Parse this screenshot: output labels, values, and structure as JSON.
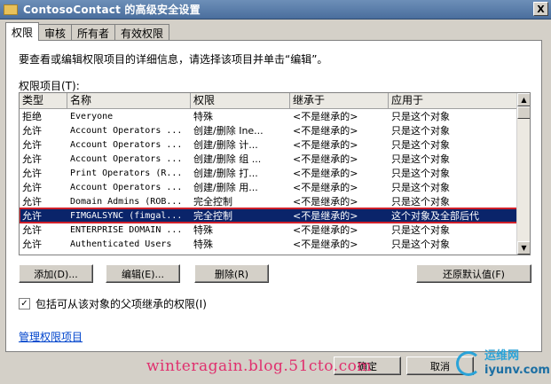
{
  "window": {
    "title": "ContosoContact 的高级安全设置",
    "close": "X"
  },
  "tabs": [
    {
      "label": "权限"
    },
    {
      "label": "审核"
    },
    {
      "label": "所有者"
    },
    {
      "label": "有效权限"
    }
  ],
  "description": "要查看或编辑权限项目的详细信息，请选择该项目并单击“编辑”。",
  "permissions_label": "权限项目(T):",
  "columns": [
    "类型",
    "名称",
    "权限",
    "继承于",
    "应用于"
  ],
  "rows": [
    [
      "拒绝",
      "Everyone",
      "特殊",
      "<不是继承的>",
      "只是这个对象"
    ],
    [
      "允许",
      "Account Operators ...",
      "创建/删除 Ine...",
      "<不是继承的>",
      "只是这个对象"
    ],
    [
      "允许",
      "Account Operators ...",
      "创建/删除 计...",
      "<不是继承的>",
      "只是这个对象"
    ],
    [
      "允许",
      "Account Operators ...",
      "创建/删除 组 ...",
      "<不是继承的>",
      "只是这个对象"
    ],
    [
      "允许",
      "Print Operators (R...",
      "创建/删除 打...",
      "<不是继承的>",
      "只是这个对象"
    ],
    [
      "允许",
      "Account Operators ...",
      "创建/删除 用...",
      "<不是继承的>",
      "只是这个对象"
    ],
    [
      "允许",
      "Domain Admins (ROB...",
      "完全控制",
      "<不是继承的>",
      "只是这个对象"
    ],
    [
      "允许",
      "FIMGALSYNC (fimgal...",
      "完全控制",
      "<不是继承的>",
      "这个对象及全部后代"
    ],
    [
      "允许",
      "ENTERPRISE DOMAIN ...",
      "特殊",
      "<不是继承的>",
      "只是这个对象"
    ],
    [
      "允许",
      "Authenticated Users",
      "特殊",
      "<不是继承的>",
      "只是这个对象"
    ]
  ],
  "buttons": {
    "add": "添加(D)...",
    "edit": "编辑(E)...",
    "remove": "删除(R)",
    "restore": "还原默认值(F)",
    "ok": "确定",
    "cancel": "取消"
  },
  "inherit_checkbox": {
    "label": "包括可从该对象的父项继承的权限(I)",
    "checked": "✓"
  },
  "manage_link": "管理权限项目",
  "watermark": "winteragain.blog.51cto.com",
  "logo": {
    "line1": "运维网",
    "line2": "iyunv.com"
  }
}
